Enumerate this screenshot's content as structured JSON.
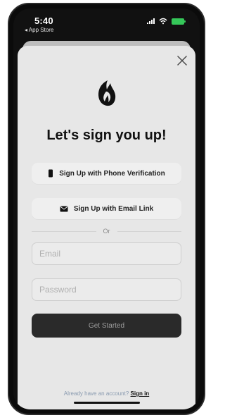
{
  "status_bar": {
    "time": "5:40",
    "back_app": "◂ App Store"
  },
  "sheet": {
    "title": "Let's sign you up!",
    "phone_button_label": "Sign Up with Phone Verification",
    "email_link_button_label": "Sign Up with Email Link",
    "divider_text": "Or",
    "email_placeholder": "Email",
    "password_placeholder": "Password",
    "submit_label": "Get Started",
    "footer_prompt": "Already have an account?",
    "footer_link": "Sign in"
  },
  "icons": {
    "close": "close-icon",
    "logo": "flame-logo-icon",
    "phone": "phone-icon",
    "email": "envelope-icon",
    "signal": "signal-icon",
    "wifi": "wifi-icon",
    "battery": "battery-icon"
  },
  "colors": {
    "sheet_bg": "#e7e7e7",
    "primary_button": "#2a2a2a",
    "battery": "#35c759",
    "footer_text": "#8a9bb0"
  }
}
